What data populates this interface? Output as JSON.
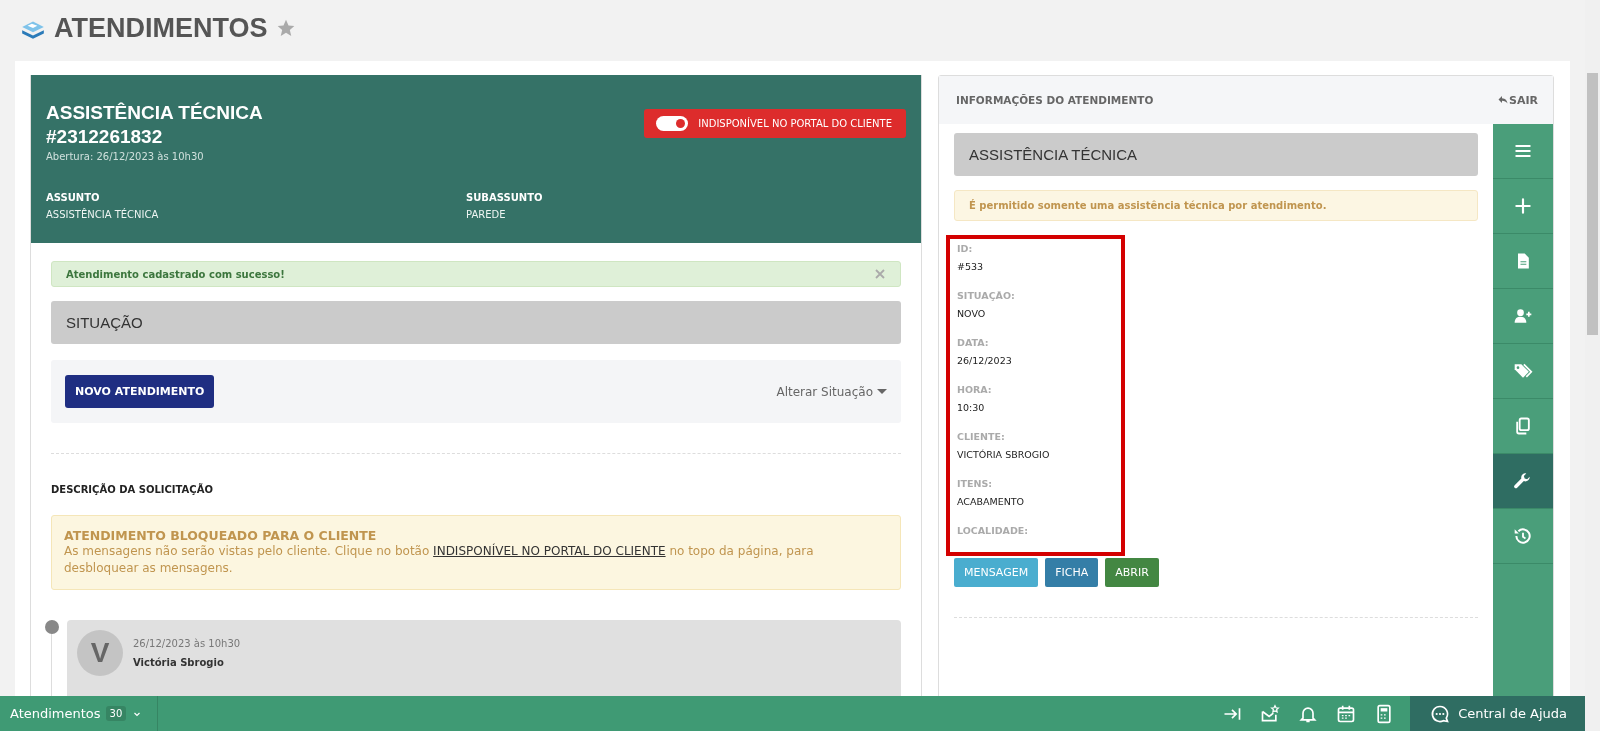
{
  "page_title": "ATENDIMENTOS",
  "favorite": false,
  "ticket": {
    "type": "ASSISTÊNCIA TÉCNICA",
    "number": "#2312261832",
    "opened": "Abertura: 26/12/2023 às 10h30",
    "portal_toggle": {
      "label": "INDISPONÍVEL NO PORTAL DO CLIENTE",
      "on": true
    },
    "fields": [
      {
        "label": "ASSUNTO",
        "value": "ASSISTÊNCIA TÉCNICA"
      },
      {
        "label": "SUBASSUNTO",
        "value": "PAREDE"
      }
    ]
  },
  "success_alert": {
    "text": "Atendimento cadastrado com sucesso!"
  },
  "situation_heading": "SITUAÇÃO",
  "new_button": "NOVO ATENDIMENTO",
  "change_status": "Alterar Situação",
  "description_heading": "DESCRIÇÃO DA SOLICITAÇÃO",
  "blocked_alert": {
    "title": "ATENDIMENTO BLOQUEADO PARA O CLIENTE",
    "text_before": "As mensagens não serão vistas pelo cliente. Clique no botão",
    "link": "INDISPONÍVEL NO PORTAL DO CLIENTE",
    "text_after": "no topo da página, para desbloquear as mensagens."
  },
  "message": {
    "avatar": "V",
    "date": "26/12/2023 às 10h30",
    "author": "Victória Sbrogio"
  },
  "info_panel": {
    "title": "INFORMAÇÕES DO ATENDIMENTO",
    "exit": "SAIR",
    "section": "ASSISTÊNCIA TÉCNICA",
    "notice": "É permitido somente uma assistência técnica por atendimento.",
    "highlighted": true,
    "fields": [
      {
        "label": "ID:",
        "value": "#533"
      },
      {
        "label": "SITUAÇÃO:",
        "value": "NOVO"
      },
      {
        "label": "DATA:",
        "value": "26/12/2023"
      },
      {
        "label": "HORA:",
        "value": "10:30"
      },
      {
        "label": "CLIENTE:",
        "value": "VICTÓRIA SBROGIO"
      },
      {
        "label": "ITENS:",
        "value": "ACABAMENTO"
      },
      {
        "label": "LOCALIDADE:"
      }
    ],
    "buttons": [
      {
        "label": "MENSAGEM",
        "kind": "info"
      },
      {
        "label": "FICHA",
        "kind": "primary"
      },
      {
        "label": "ABRIR",
        "kind": "success"
      }
    ]
  },
  "side_tools": [
    {
      "kind": "menu",
      "selected": false
    },
    {
      "kind": "plus",
      "selected": false
    },
    {
      "kind": "document",
      "selected": false
    },
    {
      "kind": "user-plus",
      "selected": false
    },
    {
      "kind": "tags",
      "selected": false
    },
    {
      "kind": "copy",
      "selected": false
    },
    {
      "kind": "wrench",
      "selected": true
    },
    {
      "kind": "history",
      "selected": false
    }
  ],
  "bottom_bar": {
    "label": "Atendimentos",
    "count": "30",
    "help": "Central de Ajuda"
  }
}
